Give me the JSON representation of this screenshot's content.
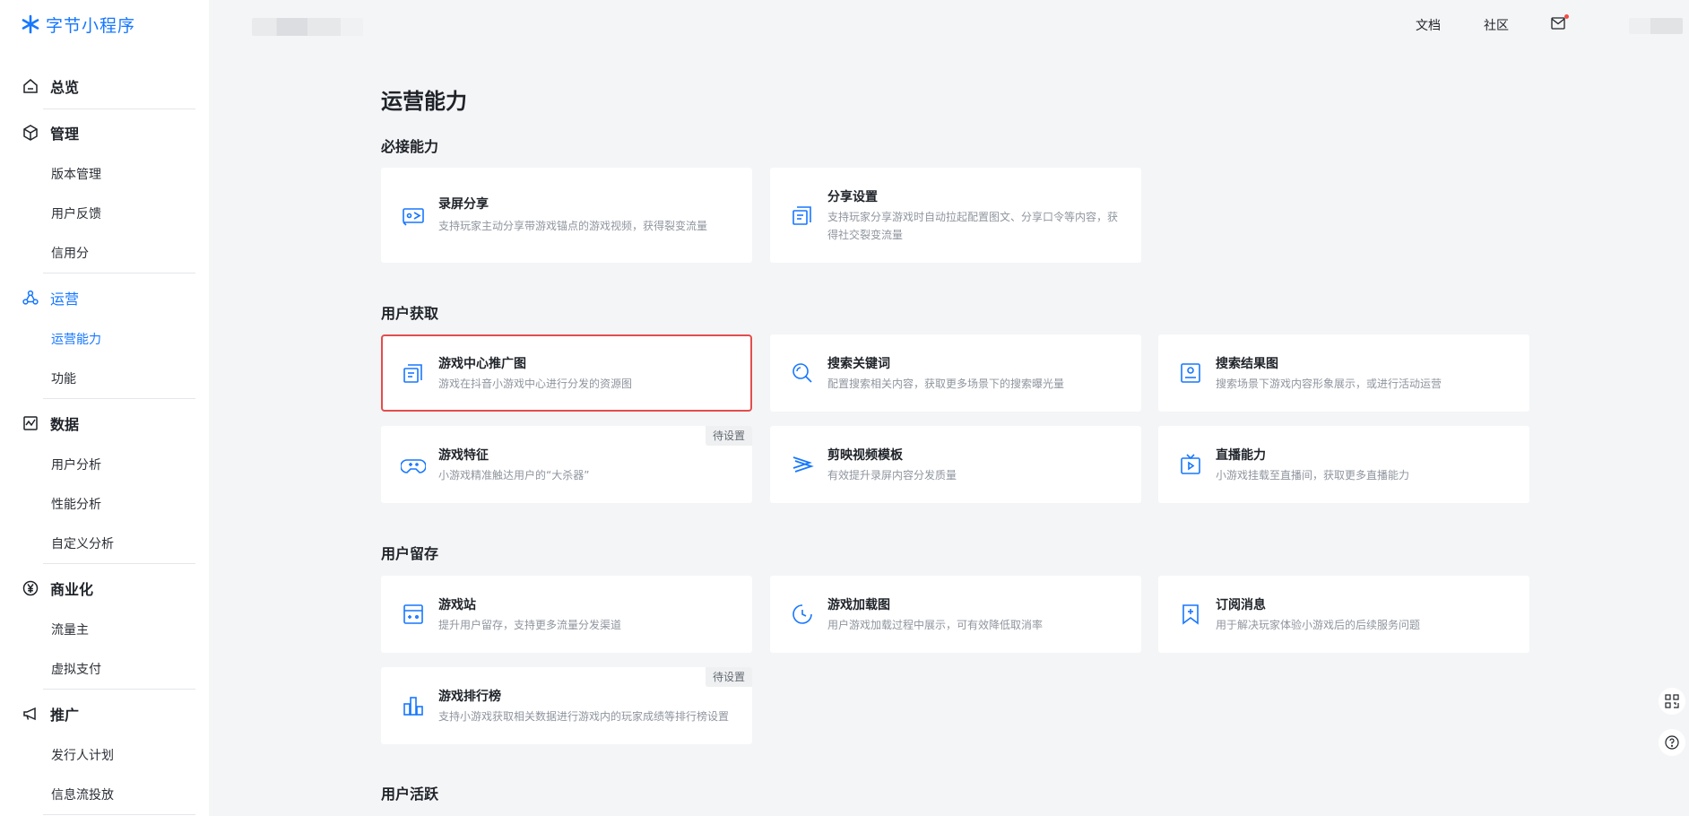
{
  "app": {
    "logo_text": "字节小程序",
    "brand_color": "#1677ff"
  },
  "header": {
    "docs_label": "文档",
    "community_label": "社区"
  },
  "sidebar": {
    "overview": "总览",
    "manage": "管理",
    "manage_items": [
      "版本管理",
      "用户反馈",
      "信用分"
    ],
    "operation": "运营",
    "operation_items": [
      "运营能力",
      "功能"
    ],
    "data": "数据",
    "data_items": [
      "用户分析",
      "性能分析",
      "自定义分析"
    ],
    "commerce": "商业化",
    "commerce_items": [
      "流量主",
      "虚拟支付"
    ],
    "promo": "推广",
    "promo_items": [
      "发行人计划",
      "信息流投放"
    ]
  },
  "main": {
    "page_title": "运营能力",
    "groups": [
      {
        "title": "必接能力",
        "cards": [
          {
            "title": "录屏分享",
            "desc": "支持玩家主动分享带游戏锚点的游戏视频，获得裂变流量",
            "icon": "screen-record-icon"
          },
          {
            "title": "分享设置",
            "desc": "支持玩家分享游戏时自动拉起配置图文、分享口令等内容，获得社交裂变流量",
            "icon": "share-settings-icon"
          }
        ]
      },
      {
        "title": "用户获取",
        "cards": [
          {
            "title": "游戏中心推广图",
            "desc": "游戏在抖音小游戏中心进行分发的资源图",
            "icon": "promo-image-icon"
          },
          {
            "title": "搜索关键词",
            "desc": "配置搜索相关内容，获取更多场景下的搜索曝光量",
            "icon": "search-keyword-icon"
          },
          {
            "title": "搜索结果图",
            "desc": "搜索场景下游戏内容形象展示，或进行活动运营",
            "icon": "search-result-icon"
          },
          {
            "title": "游戏特征",
            "desc": "小游戏精准触达用户的“大杀器”",
            "icon": "gamepad-icon",
            "badge": "待设置"
          },
          {
            "title": "剪映视频模板",
            "desc": "有效提升录屏内容分发质量",
            "icon": "capcut-icon"
          },
          {
            "title": "直播能力",
            "desc": "小游戏挂载至直播间，获取更多直播能力",
            "icon": "live-tv-icon"
          }
        ]
      },
      {
        "title": "用户留存",
        "cards": [
          {
            "title": "游戏站",
            "desc": "提升用户留存，支持更多流量分发渠道",
            "icon": "game-station-icon"
          },
          {
            "title": "游戏加载图",
            "desc": "用户游戏加载过程中展示，可有效降低取消率",
            "icon": "loading-clock-icon"
          },
          {
            "title": "订阅消息",
            "desc": "用于解决玩家体验小游戏后的后续服务问题",
            "icon": "subscribe-bookmark-icon"
          },
          {
            "title": "游戏排行榜",
            "desc": "支持小游戏获取相关数据进行游戏内的玩家成绩等排行榜设置",
            "icon": "leaderboard-icon",
            "badge": "待设置"
          }
        ]
      },
      {
        "title": "用户活跃"
      }
    ]
  },
  "highlight_color": "#e34d4d"
}
